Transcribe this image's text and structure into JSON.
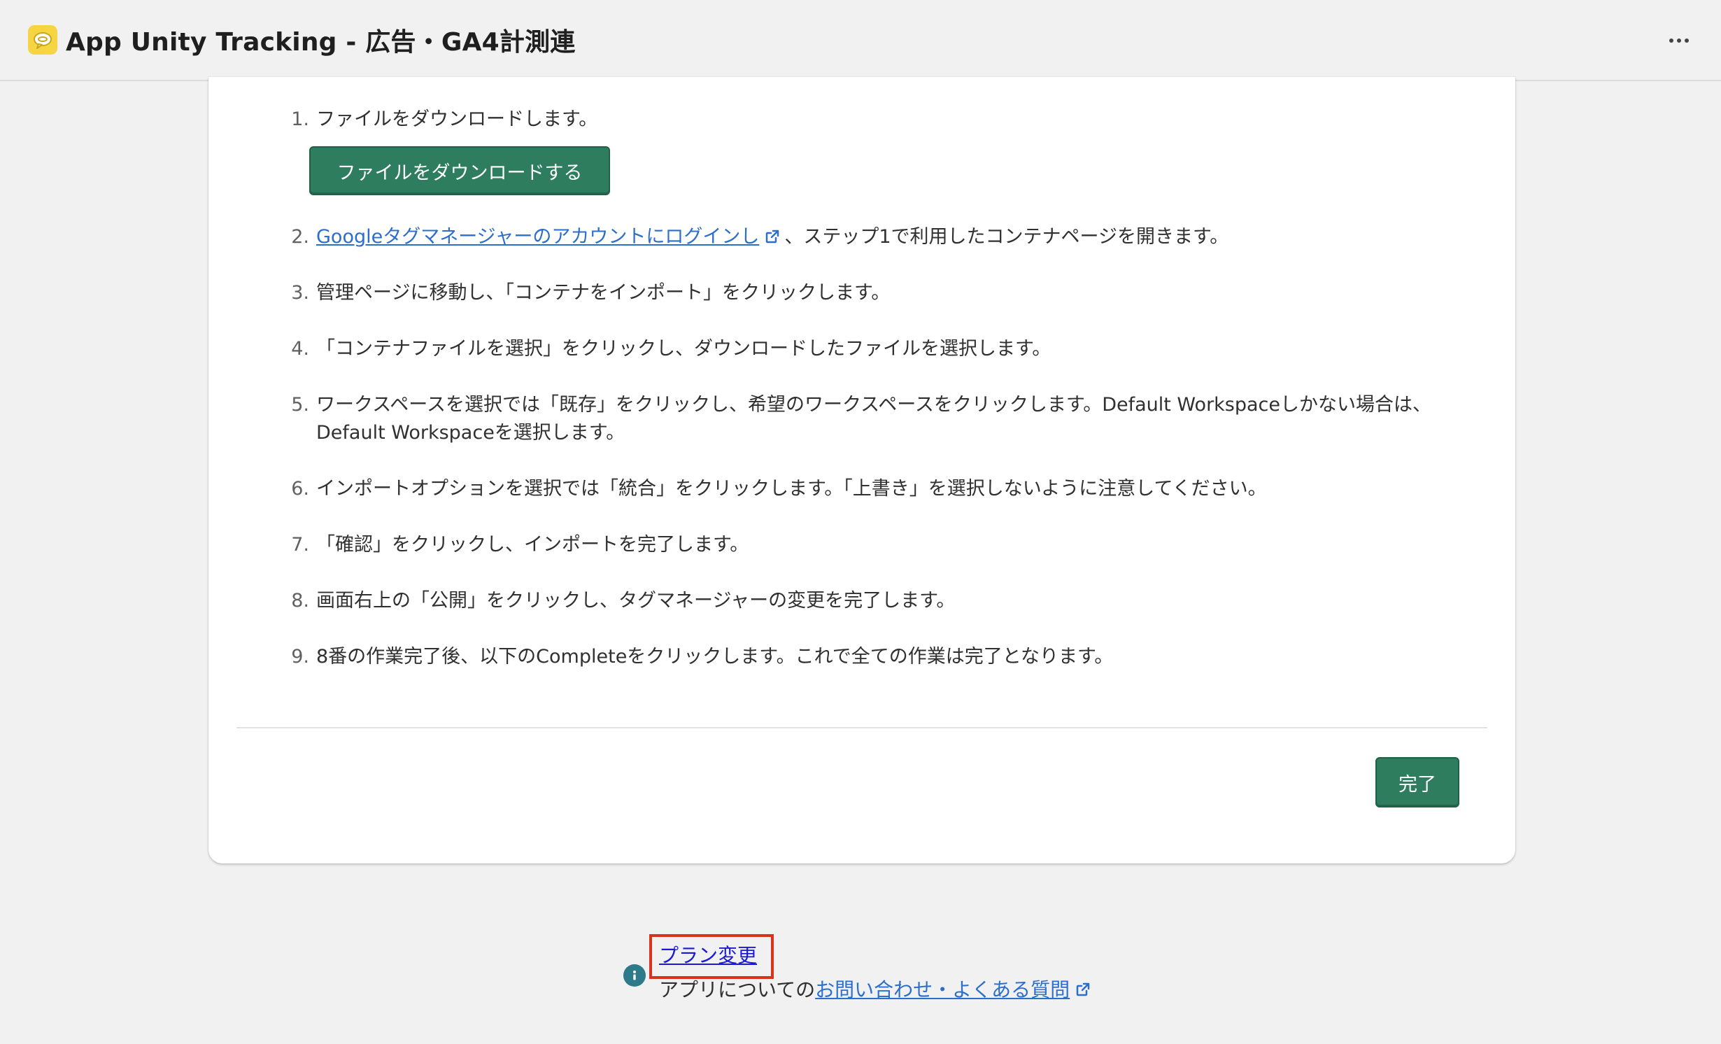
{
  "app": {
    "title": "App Unity Tracking - 広告・GA4計測連",
    "logo_icon": "chat-bubble-icon",
    "more_icon": "more-horizontal-icon"
  },
  "steps": [
    {
      "num": "1.",
      "text": "ファイルをダウンロードします。"
    },
    {
      "num": "2.",
      "link": "Googleタグマネージャーのアカウントにログインし",
      "text": "、ステップ1で利用したコンテナページを開きます。"
    },
    {
      "num": "3.",
      "text": "管理ページに移動し、「コンテナをインポート」をクリックします。"
    },
    {
      "num": "4.",
      "text": "「コンテナファイルを選択」をクリックし、ダウンロードしたファイルを選択します。"
    },
    {
      "num": "5.",
      "text": "ワークスペースを選択では「既存」をクリックし、希望のワークスペースをクリックします。Default Workspaceしかない場合は、",
      "text2": "Default Workspaceを選択します。"
    },
    {
      "num": "6.",
      "text": "インポートオプションを選択では「統合」をクリックします。「上書き」を選択しないように注意してください。"
    },
    {
      "num": "7.",
      "text": "「確認」をクリックし、インポートを完了します。"
    },
    {
      "num": "8.",
      "text": "画面右上の「公開」をクリックし、タグマネージャーの変更を完了します。"
    },
    {
      "num": "9.",
      "text": "8番の作業完了後、以下のCompleteをクリックします。これで全ての作業は完了となります。"
    }
  ],
  "buttons": {
    "download": "ファイルをダウンロードする",
    "done": "完了"
  },
  "footer": {
    "plan_change": "プラン変更",
    "help_prefix": "アプリについての",
    "help_link": "お問い合わせ・よくある質問"
  },
  "colors": {
    "primary": "#2f7d5f",
    "link": "#2c6ecb",
    "highlight_box": "#d9331f",
    "info": "#2c7a8a"
  }
}
